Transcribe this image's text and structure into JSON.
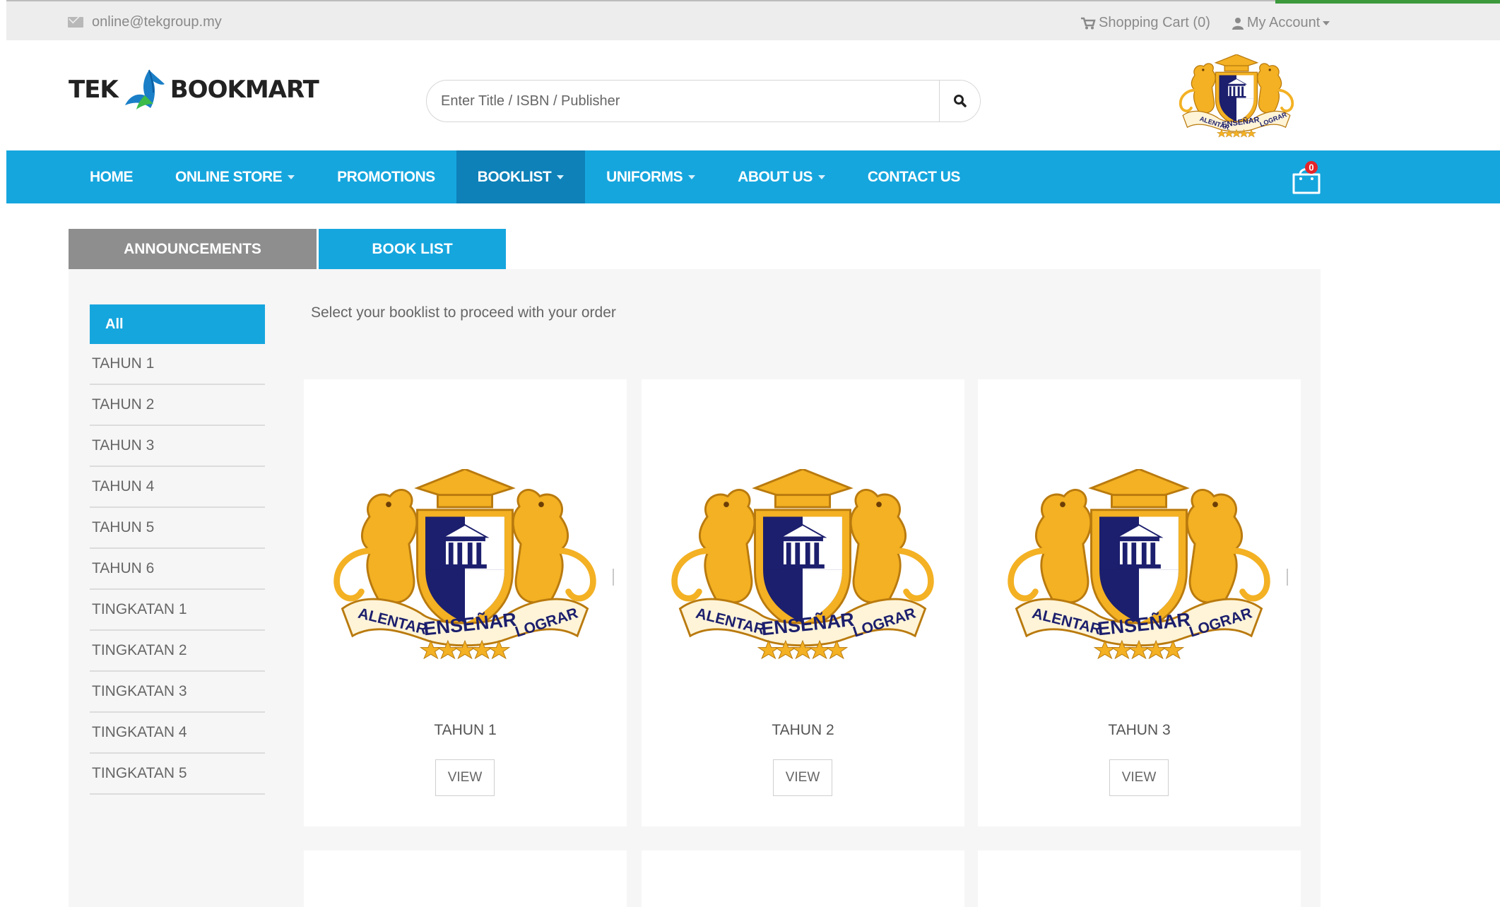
{
  "topbar": {
    "email": "online@tekgroup.my",
    "cart": "Shopping Cart (0)",
    "account": "My Account"
  },
  "header": {
    "logo_left": "TEK",
    "logo_right": "BOOKMART",
    "search_placeholder": "Enter Title / ISBN / Publisher"
  },
  "nav": {
    "items": [
      {
        "label": "HOME",
        "dropdown": false
      },
      {
        "label": "ONLINE STORE",
        "dropdown": true
      },
      {
        "label": "PROMOTIONS",
        "dropdown": false
      },
      {
        "label": "BOOKLIST",
        "dropdown": true
      },
      {
        "label": "UNIFORMS",
        "dropdown": true
      },
      {
        "label": "ABOUT US",
        "dropdown": true
      },
      {
        "label": "CONTACT US",
        "dropdown": false
      }
    ],
    "cart_count": "0"
  },
  "tabs": {
    "announcements": "ANNOUNCEMENTS",
    "booklist": "BOOK LIST"
  },
  "sidebar": {
    "all": "All",
    "items": [
      "TAHUN 1",
      "TAHUN 2",
      "TAHUN 3",
      "TAHUN 4",
      "TAHUN 5",
      "TAHUN 6",
      "TINGKATAN 1",
      "TINGKATAN 2",
      "TINGKATAN 3",
      "TINGKATAN 4",
      "TINGKATAN 5"
    ]
  },
  "main": {
    "intro": "Select your booklist to proceed with your order",
    "cards": [
      {
        "name": "TAHUN 1",
        "button": "VIEW"
      },
      {
        "name": "TAHUN 2",
        "button": "VIEW"
      },
      {
        "name": "TAHUN 3",
        "button": "VIEW"
      }
    ]
  },
  "crest": {
    "left_ribbon": "ALENTAR",
    "center_ribbon": "ENSEÑAR",
    "right_ribbon": "LOGRAR"
  },
  "colors": {
    "primary": "#16a6de",
    "primary_dark": "#0d81b8",
    "tab_gray": "#8e8e8e",
    "crest_gold": "#f3b123",
    "crest_navy": "#1c1f6d",
    "badge_red": "#e5242a"
  }
}
